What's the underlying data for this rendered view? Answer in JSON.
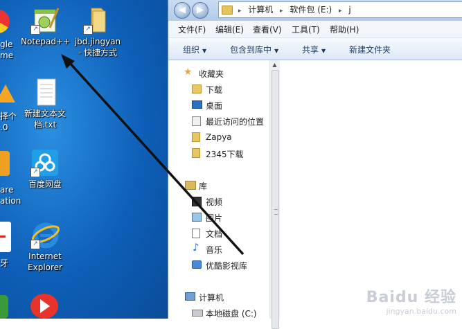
{
  "desktop": {
    "edge_labels": [
      {
        "id": "chrome",
        "text": "gle\nme"
      },
      {
        "id": "huawei",
        "text": "择个\n.0"
      },
      {
        "id": "vmware",
        "text": "are\nation"
      },
      {
        "id": "mail",
        "text": "牙"
      }
    ],
    "icons": {
      "notepad": "Notepad++",
      "jbd": "jbd.jingyan\n- 快捷方式",
      "newtext": "新建文本文\n档.txt",
      "baidu": "百度网盘",
      "ie": "Internet\nExplorer"
    }
  },
  "explorer": {
    "address": {
      "seg1": "计算机",
      "seg2": "软件包 (E:)",
      "seg3": "j"
    },
    "menus": [
      "文件(F)",
      "编辑(E)",
      "查看(V)",
      "工具(T)",
      "帮助(H)"
    ],
    "tools": {
      "organize": "组织",
      "include": "包含到库中",
      "share": "共享",
      "new_folder": "新建文件夹"
    },
    "nav": {
      "favorites": "收藏夹",
      "downloads": "下载",
      "desktop": "桌面",
      "recent": "最近访问的位置",
      "zapya": "Zapya",
      "dl2345": "2345下载",
      "libraries": "库",
      "videos": "视频",
      "pictures": "图片",
      "documents": "文档",
      "music": "音乐",
      "youku": "优酷影视库",
      "computer": "计算机",
      "local_c": "本地磁盘 (C:)"
    }
  },
  "watermark": {
    "brand": "Baidu 经验",
    "url": "jingyan.baidu.com"
  }
}
